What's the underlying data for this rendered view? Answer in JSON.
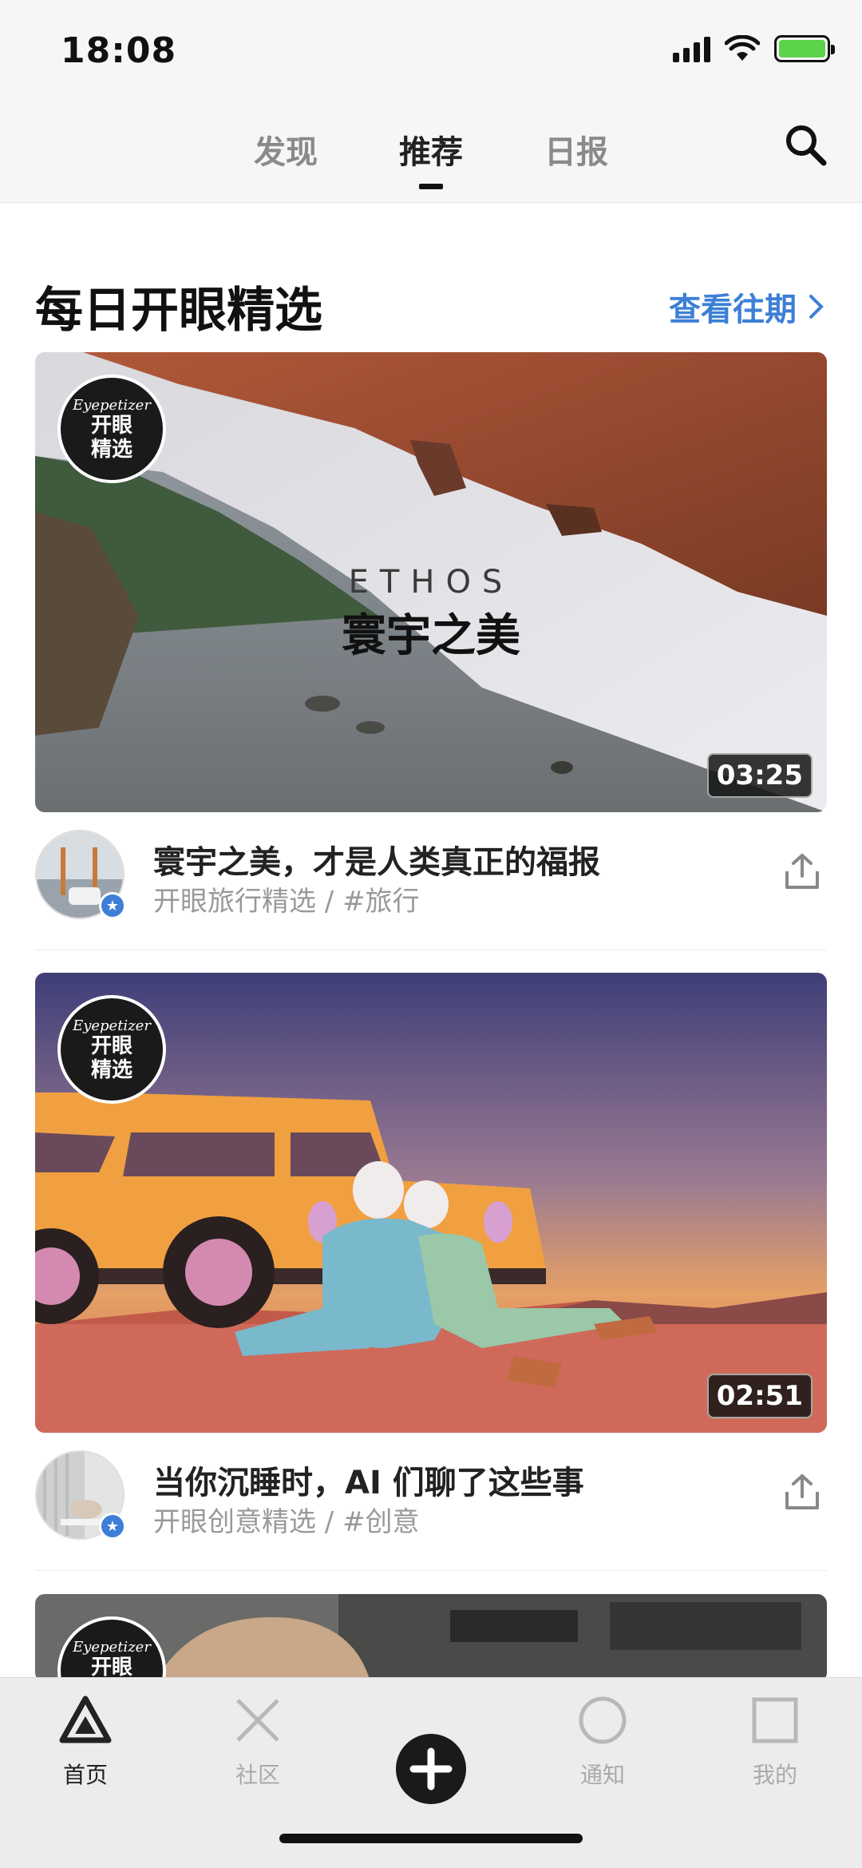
{
  "status_bar": {
    "time": "18:08"
  },
  "top_nav": {
    "tabs": [
      {
        "label": "发现"
      },
      {
        "label": "推荐"
      },
      {
        "label": "日报"
      }
    ],
    "active_tab": "推荐"
  },
  "section": {
    "title": "每日开眼精选",
    "view_past": "查看往期"
  },
  "badge": {
    "brand": "Eyepetizer",
    "text": "开眼精选"
  },
  "cards": [
    {
      "thumb_title_en": "ETHOS",
      "thumb_title_cn": "寰宇之美",
      "duration": "03:25",
      "title": "寰宇之美，才是人类真正的福报",
      "subtitle": "开眼旅行精选  /  #旅行"
    },
    {
      "duration": "02:51",
      "title": "当你沉睡时，AI 们聊了这些事",
      "subtitle": "开眼创意精选  /  #创意"
    }
  ],
  "tab_bar": {
    "items": [
      {
        "label": "首页",
        "icon": "triangle-icon"
      },
      {
        "label": "社区",
        "icon": "cross-icon"
      },
      {
        "label": "",
        "icon": "plus-icon"
      },
      {
        "label": "通知",
        "icon": "circle-icon"
      },
      {
        "label": "我的",
        "icon": "square-icon"
      }
    ],
    "active": "首页"
  },
  "colors": {
    "accent": "#3d7fd6",
    "battery": "#5bd34a"
  }
}
